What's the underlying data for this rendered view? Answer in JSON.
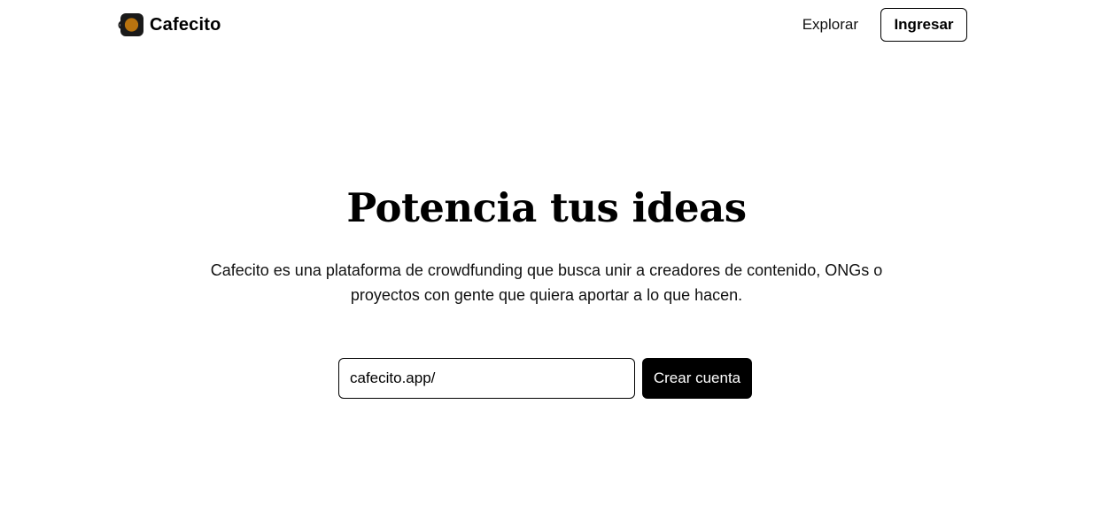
{
  "brand": {
    "name": "Cafecito",
    "logo_icon": "coffee-cup-logo-icon",
    "colors": {
      "logo_dark": "#1a1a1a",
      "logo_accent": "#b8730f"
    }
  },
  "header": {
    "nav": {
      "explore_label": "Explorar",
      "login_label": "Ingresar"
    }
  },
  "hero": {
    "title": "Potencia tus ideas",
    "description": "Cafecito es una plataforma de crowdfunding que busca unir a creadores de contenido, ONGs o proyectos con gente que quiera aportar a lo que hacen."
  },
  "signup": {
    "url_value": "cafecito.app/",
    "create_account_label": "Crear cuenta",
    "button_color": "#000000"
  }
}
